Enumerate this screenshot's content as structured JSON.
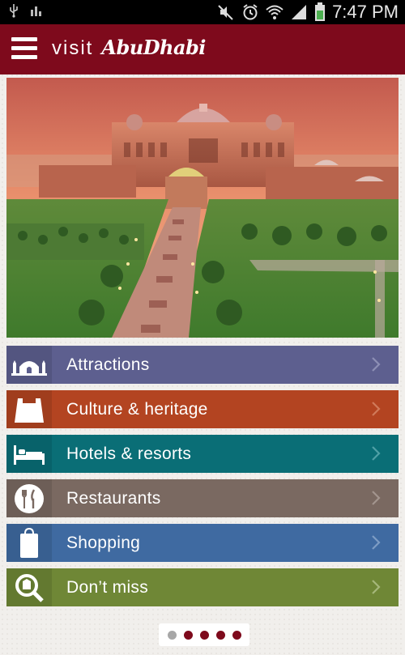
{
  "status_bar": {
    "time": "7:47 PM",
    "icons": [
      "usb-icon",
      "bars-icon",
      "mute-icon",
      "alarm-icon",
      "wifi-icon",
      "signal-icon",
      "battery-icon"
    ]
  },
  "app_bar": {
    "visit_text": "visit",
    "logo_text": "AbuDhabi",
    "menu_icon": "hamburger-menu-icon",
    "color": "#7e0a1c"
  },
  "hero": {
    "image_subject": "palace-photo"
  },
  "menu": {
    "items": [
      {
        "label": "Attractions",
        "icon": "mosque-icon",
        "color": "#5d5f8f"
      },
      {
        "label": "Culture & heritage",
        "icon": "fort-icon",
        "color": "#b34421"
      },
      {
        "label": "Hotels & resorts",
        "icon": "bed-icon",
        "color": "#0a6e76"
      },
      {
        "label": "Restaurants",
        "icon": "cutlery-icon",
        "color": "#7a6961"
      },
      {
        "label": "Shopping",
        "icon": "shopping-bag-icon",
        "color": "#3f6aa1"
      },
      {
        "label": "Don’t miss",
        "icon": "magnifier-icon",
        "color": "#6f8736"
      }
    ]
  },
  "pager": {
    "count": 5,
    "active_index": 0
  }
}
